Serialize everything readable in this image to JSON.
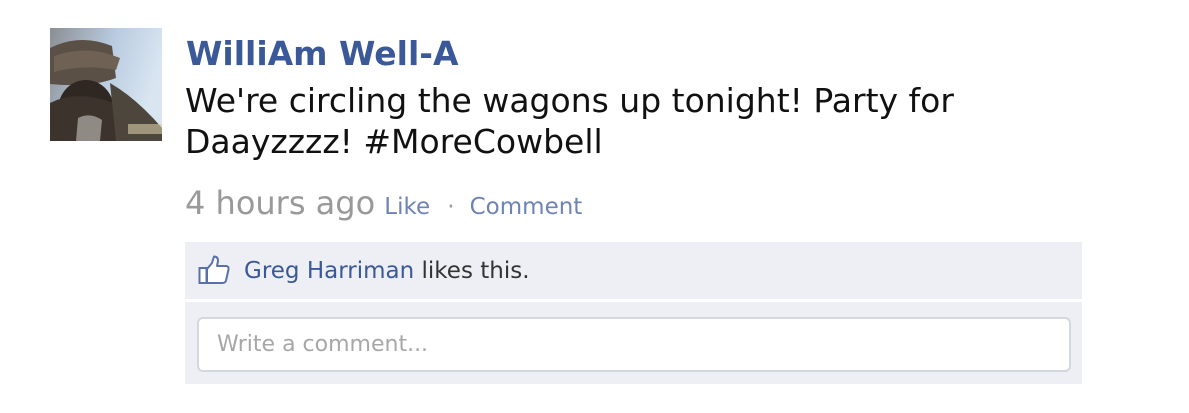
{
  "post": {
    "author": "WilliAm Well-A",
    "message": "We're circling the wagons up tonight! Party for Daayzzzz! #MoreCowbell",
    "timestamp": "4 hours ago",
    "actions": {
      "like_label": "Like",
      "separator": "·",
      "comment_label": "Comment"
    }
  },
  "likes": {
    "icon": "thumbs-up-icon",
    "liker_name": "Greg Harriman",
    "suffix": " likes this."
  },
  "comment_box": {
    "placeholder": "Write a comment..."
  },
  "colors": {
    "link_blue": "#3b5998",
    "light_link_blue": "#6d84b4",
    "panel_background": "#edeff4",
    "muted_gray": "#999999"
  }
}
